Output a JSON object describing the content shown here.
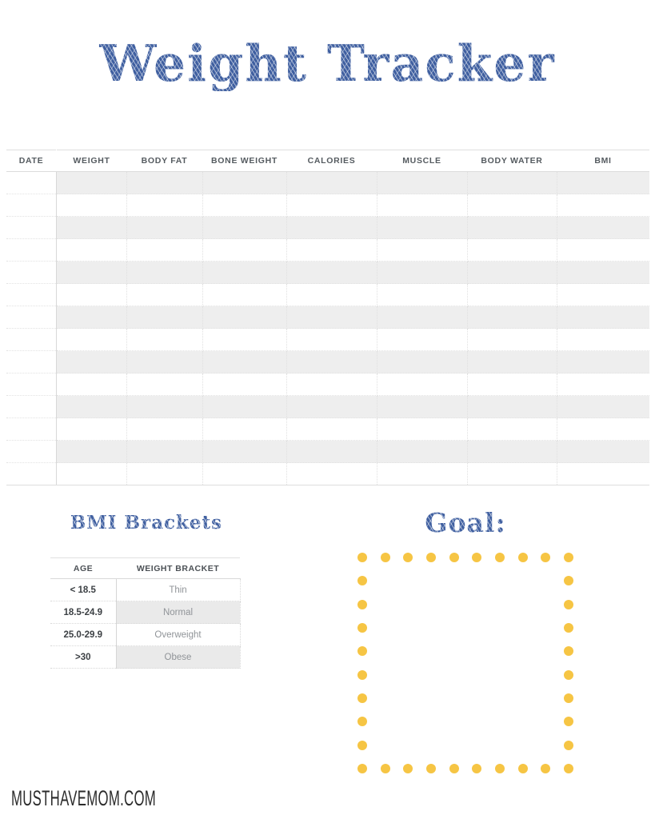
{
  "page": {
    "title": "Weight Tracker",
    "background_color": "#ffffff",
    "accent_blue": "#41619e",
    "accent_yellow": "#f6c544",
    "stripe_gray": "#eeeeee"
  },
  "tracker_table": {
    "name": "weight-tracker-table",
    "columns": [
      "DATE",
      "WEIGHT",
      "BODY FAT",
      "BONE WEIGHT",
      "CALORIES",
      "MUSCLE",
      "BODY WATER",
      "BMI"
    ],
    "row_count": 14,
    "rows_are_blank": true,
    "cells": [
      [
        "",
        "",
        "",
        "",
        "",
        "",
        "",
        ""
      ],
      [
        "",
        "",
        "",
        "",
        "",
        "",
        "",
        ""
      ],
      [
        "",
        "",
        "",
        "",
        "",
        "",
        "",
        ""
      ],
      [
        "",
        "",
        "",
        "",
        "",
        "",
        "",
        ""
      ],
      [
        "",
        "",
        "",
        "",
        "",
        "",
        "",
        ""
      ],
      [
        "",
        "",
        "",
        "",
        "",
        "",
        "",
        ""
      ],
      [
        "",
        "",
        "",
        "",
        "",
        "",
        "",
        ""
      ],
      [
        "",
        "",
        "",
        "",
        "",
        "",
        "",
        ""
      ],
      [
        "",
        "",
        "",
        "",
        "",
        "",
        "",
        ""
      ],
      [
        "",
        "",
        "",
        "",
        "",
        "",
        "",
        ""
      ],
      [
        "",
        "",
        "",
        "",
        "",
        "",
        "",
        ""
      ],
      [
        "",
        "",
        "",
        "",
        "",
        "",
        "",
        ""
      ],
      [
        "",
        "",
        "",
        "",
        "",
        "",
        "",
        ""
      ],
      [
        "",
        "",
        "",
        "",
        "",
        "",
        "",
        ""
      ]
    ]
  },
  "bmi_section": {
    "heading": "BMI Brackets",
    "columns": [
      "AGE",
      "WEIGHT BRACKET"
    ],
    "rows": [
      {
        "age": "< 18.5",
        "bracket": "Thin"
      },
      {
        "age": "18.5-24.9",
        "bracket": "Normal"
      },
      {
        "age": "25.0-29.9",
        "bracket": "Overweight"
      },
      {
        "age": ">30",
        "bracket": "Obese"
      }
    ]
  },
  "goal_section": {
    "heading": "Goal:",
    "value": "",
    "border_style": "dotted",
    "dot_color": "#f6c544",
    "dots_across": 10,
    "dots_down": 10
  },
  "footer": {
    "brand": "MUSTHAVEMOM.COM"
  }
}
